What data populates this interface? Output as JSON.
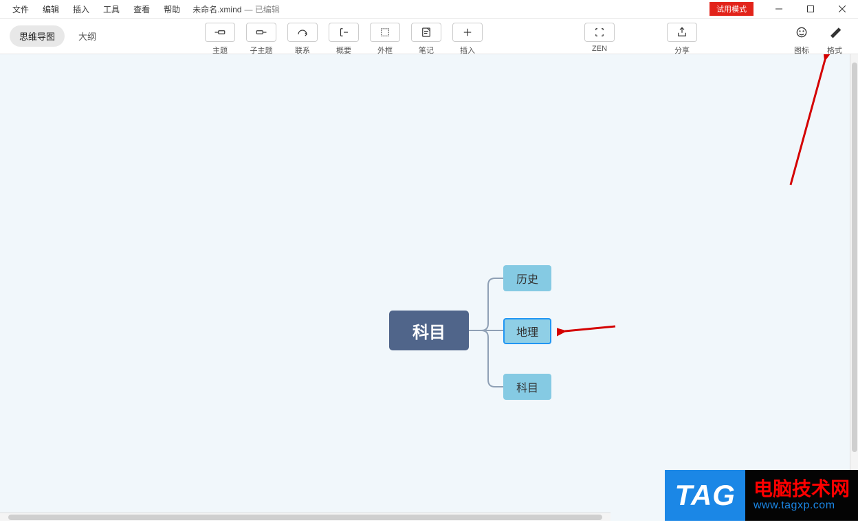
{
  "menu": {
    "file": "文件",
    "edit": "编辑",
    "insert": "插入",
    "tools": "工具",
    "view": "查看",
    "help": "帮助"
  },
  "filename": "未命名.xmind",
  "filestatus": "— 已编辑",
  "trial_badge": "试用模式",
  "view_tabs": {
    "mindmap": "思维导图",
    "outline": "大纲"
  },
  "tools": {
    "topic": "主题",
    "subtopic": "子主题",
    "relation": "联系",
    "summary": "概要",
    "boundary": "外框",
    "note": "笔记",
    "insert": "插入"
  },
  "mid_tools": {
    "zen": "ZEN",
    "share": "分享"
  },
  "right_tools": {
    "marker": "图标",
    "format": "格式"
  },
  "mindmap": {
    "central": "科目",
    "sub1": "历史",
    "sub2": "地理",
    "sub3": "科目"
  },
  "watermark": {
    "tag": "TAG",
    "line1": "电脑技术网",
    "line2": "www.tagxp.com"
  }
}
